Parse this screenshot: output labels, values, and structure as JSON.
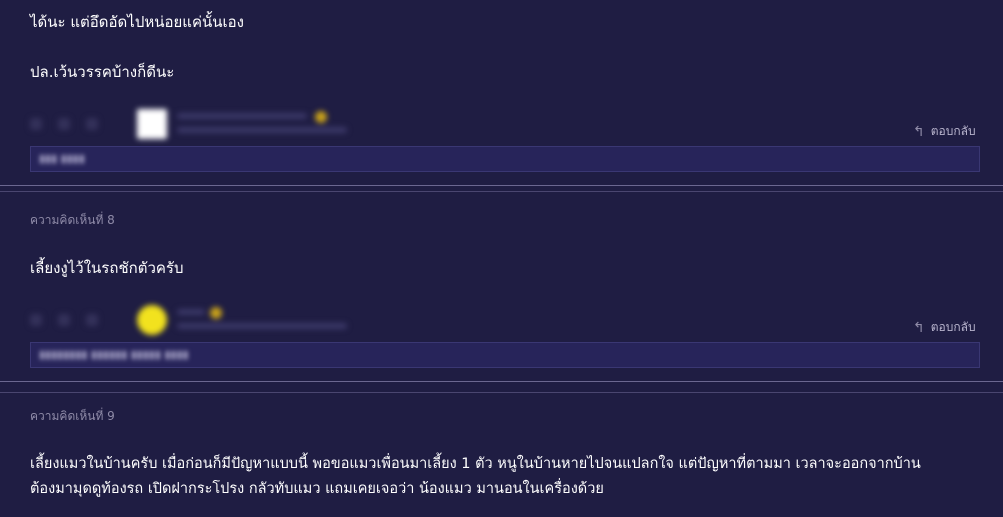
{
  "comments": [
    {
      "lines": [
        "ได้นะ แต่อึดอัดไปหน่อยแค่นั้นเอง",
        "ปล.เว้นวรรคบ้างก็ดีนะ"
      ],
      "reply_label": "ตอบกลับ",
      "reply_icon": "reply-arrow-icon",
      "avatar_color": "#ffffff"
    },
    {
      "label": "ความคิดเห็นที่ 8",
      "lines": [
        "เลี้ยงงูไว้ในรถชักตัวครับ"
      ],
      "reply_label": "ตอบกลับ",
      "reply_icon": "reply-arrow-icon",
      "avatar_color": "#f2e21e"
    },
    {
      "label": "ความคิดเห็นที่ 9",
      "lines": [
        "เลี้ยงแมวในบ้านครับ  เมื่อก่อนก็มีปัญหาแบบนี้  พอขอแมวเพื่อนมาเลี้ยง 1 ตัว หนูในบ้านหายไปจนแปลกใจ  แต่ปัญหาที่ตามมา เวลาจะออกจากบ้าน",
        "ต้องมามุดดูท้องรถ เปิดฝากระโปรง กลัวทับแมว แถมเคยเจอว่า น้องแมว มานอนในเครื่องด้วย"
      ]
    }
  ],
  "colors": {
    "background": "#1f1d43",
    "text": "#ffffff",
    "muted": "#8f8ba8",
    "separator": "#6b6790"
  }
}
